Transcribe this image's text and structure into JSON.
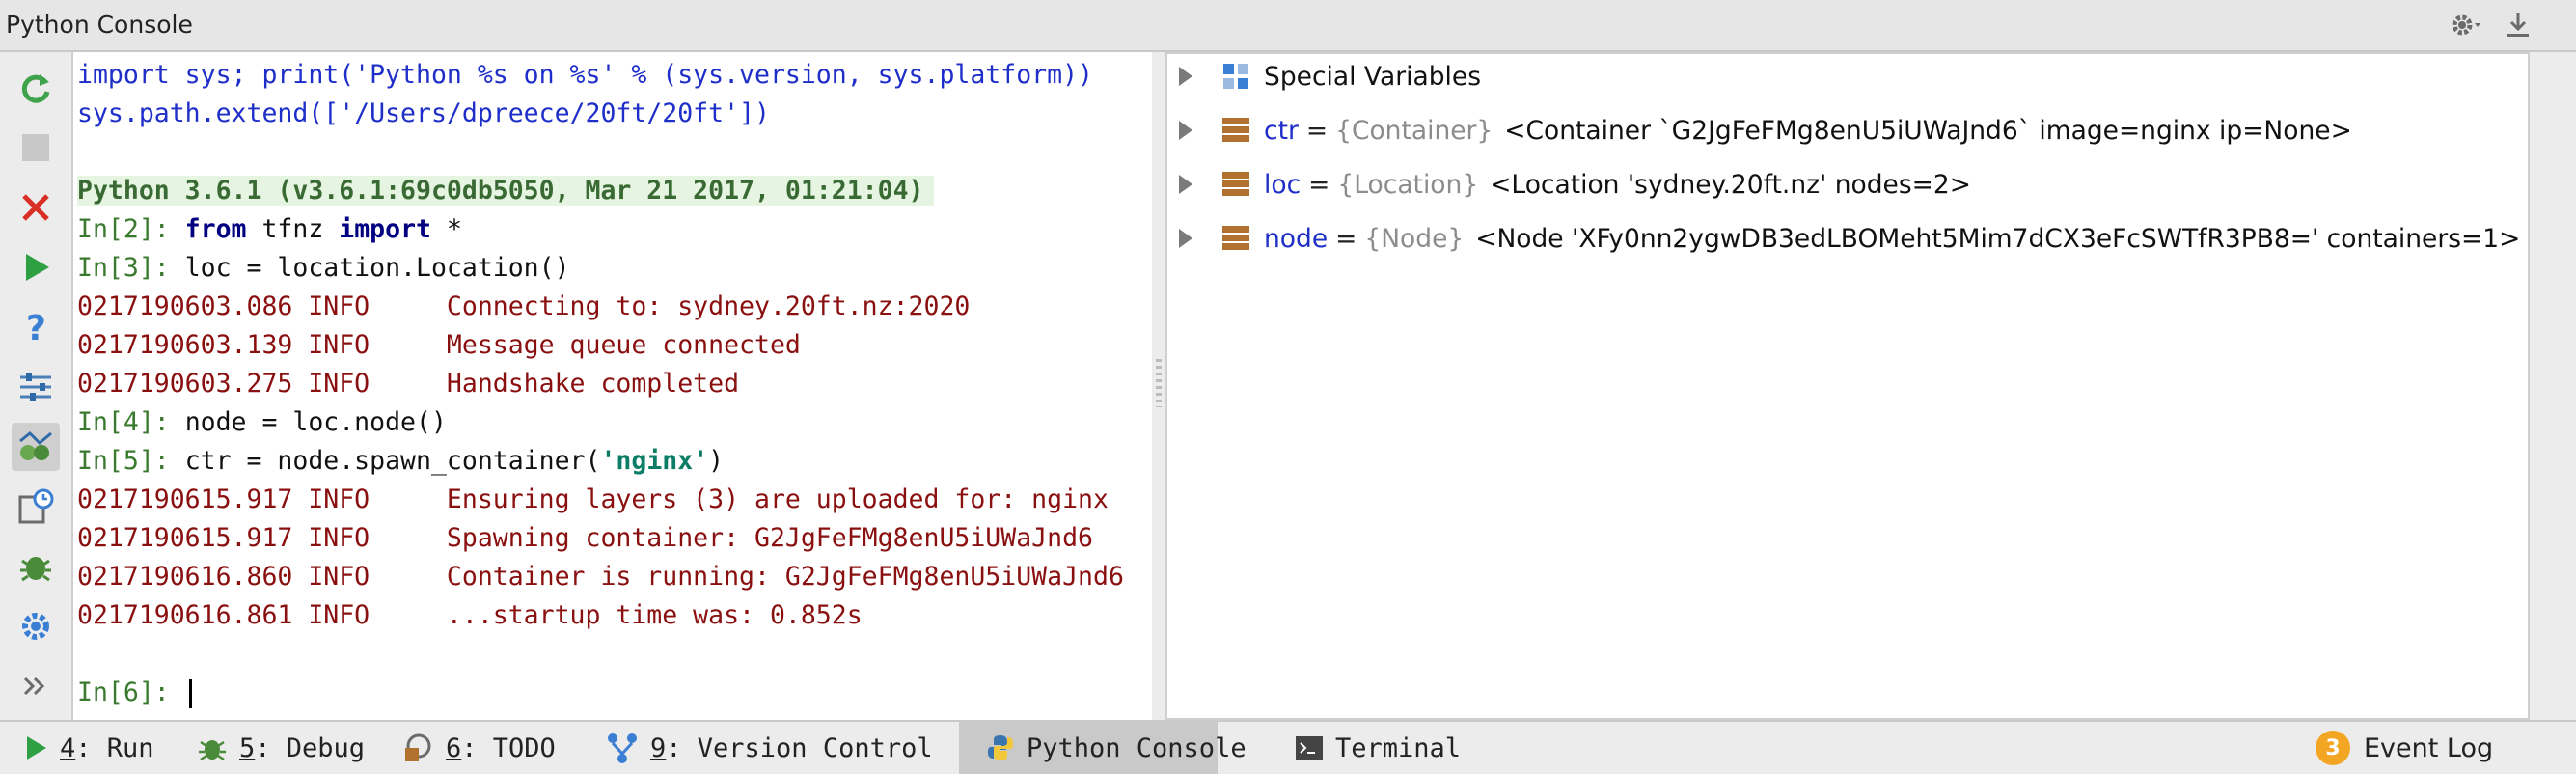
{
  "window": {
    "title": "Python Console"
  },
  "console": {
    "lines": [
      {
        "segments": [
          {
            "text": "import sys; print('Python %s on %s' % (sys.version, sys.platform))",
            "cls": "blue"
          }
        ]
      },
      {
        "segments": [
          {
            "text": "sys.path.extend(['/Users/dpreece/20ft/20ft'])",
            "cls": "blue"
          }
        ]
      },
      {
        "segments": []
      },
      {
        "segments": [
          {
            "text": "Python 3.6.1 (v3.6.1:69c0db5050, Mar 21 2017, 01:21:04)",
            "cls": "banner"
          }
        ]
      },
      {
        "segments": [
          {
            "text": "In[2]: ",
            "cls": "green"
          },
          {
            "text": "from",
            "cls": "kw"
          },
          {
            "text": " tfnz ",
            "cls": "dark"
          },
          {
            "text": "import",
            "cls": "kw"
          },
          {
            "text": " *",
            "cls": "dark"
          }
        ]
      },
      {
        "segments": [
          {
            "text": "In[3]: ",
            "cls": "green"
          },
          {
            "text": "loc = location.Location()",
            "cls": "dark"
          }
        ]
      },
      {
        "segments": [
          {
            "text": "0217190603.086 INFO     Connecting to: sydney.20ft.nz:2020",
            "cls": "red"
          }
        ]
      },
      {
        "segments": [
          {
            "text": "0217190603.139 INFO     Message queue connected",
            "cls": "red"
          }
        ]
      },
      {
        "segments": [
          {
            "text": "0217190603.275 INFO     Handshake completed",
            "cls": "red"
          }
        ]
      },
      {
        "segments": [
          {
            "text": "In[4]: ",
            "cls": "green"
          },
          {
            "text": "node = loc.node()",
            "cls": "dark"
          }
        ]
      },
      {
        "segments": [
          {
            "text": "In[5]: ",
            "cls": "green"
          },
          {
            "text": "ctr = node.spawn_container(",
            "cls": "dark"
          },
          {
            "text": "'nginx'",
            "cls": "str"
          },
          {
            "text": ")",
            "cls": "dark"
          }
        ]
      },
      {
        "segments": [
          {
            "text": "0217190615.917 INFO     Ensuring layers (3) are uploaded for: nginx",
            "cls": "red"
          }
        ]
      },
      {
        "segments": [
          {
            "text": "0217190615.917 INFO     Spawning container: G2JgFeFMg8enU5iUWaJnd6",
            "cls": "red"
          }
        ]
      },
      {
        "segments": [
          {
            "text": "0217190616.860 INFO     Container is running: G2JgFeFMg8enU5iUWaJnd6",
            "cls": "red"
          }
        ]
      },
      {
        "segments": [
          {
            "text": "0217190616.861 INFO     ...startup time was: 0.852s",
            "cls": "red"
          }
        ]
      }
    ],
    "prompt": "In[6]:"
  },
  "variables": {
    "special": "Special Variables",
    "items": [
      {
        "name": "ctr",
        "eq": "=",
        "type": "{Container}",
        "value": "<Container `G2JgFeFMg8enU5iUWaJnd6` image=nginx ip=None>"
      },
      {
        "name": "loc",
        "eq": "=",
        "type": "{Location}",
        "value": "<Location 'sydney.20ft.nz' nodes=2>"
      },
      {
        "name": "node",
        "eq": "=",
        "type": "{Node}",
        "value": "<Node 'XFy0nn2ygwDB3edLBOMeht5Mim7dCX3eFcSWTfR3PB8=' containers=1>"
      }
    ]
  },
  "bottom_tabs": {
    "run": {
      "num": "4",
      "label": ": Run"
    },
    "debug": {
      "num": "5",
      "label": ": Debug"
    },
    "todo": {
      "num": "6",
      "label": ": TODO"
    },
    "vcs": {
      "num": "9",
      "label": ": Version Control"
    },
    "python_console": {
      "label": "Python Console"
    },
    "terminal": {
      "label": "Terminal"
    },
    "event_log": {
      "badge": "3",
      "label": "Event Log"
    }
  },
  "colors": {
    "accent_green": "#2ea043",
    "error_red": "#d93025",
    "badge_orange": "#f2a623"
  },
  "icons": {
    "titlebar": [
      "gear-icon",
      "download-icon"
    ],
    "leftbar": [
      "rerun-icon",
      "stop-icon",
      "close-icon",
      "run-icon",
      "help-icon",
      "settings-sliders-icon",
      "show-variables-icon",
      "history-icon",
      "debug-icon",
      "gear-icon",
      "more-icon"
    ]
  }
}
